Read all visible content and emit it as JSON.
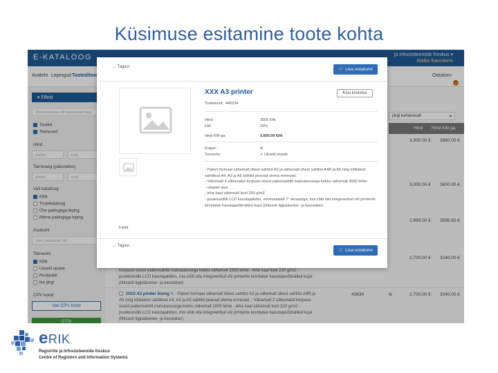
{
  "slide": {
    "title": "Küsimuse esitamine toote kohta"
  },
  "app": {
    "logo": "E-KATALOOG",
    "org_name": "ja Infosüsteemide Keskus",
    "user_name": "Maiko Kannikere",
    "nav": [
      "Avaleht",
      "Lepingud",
      "Tooted/teenu"
    ],
    "cart_label": "Ostukorv",
    "cart_count": "0"
  },
  "sidebar": {
    "filter_title": "Filtrid",
    "search_placeholder": "Otsi nimetuse või tootekoodi järgi",
    "types": [
      {
        "label": "Tooted",
        "checked": true
      },
      {
        "label": "Teenused",
        "checked": true
      }
    ],
    "price_label": "Hind",
    "price_from": "alates",
    "price_to": "kuni",
    "delivery_label": "Tarneaeg (päevades)",
    "delivery_from": "alates",
    "delivery_to": "kuni",
    "catalog_label": "Vali kataloog",
    "catalogs": [
      {
        "label": "Kõik",
        "checked": true
      },
      {
        "label": "Tootekataloog",
        "checked": false
      },
      {
        "label": "Ühe pakkujaga leping",
        "checked": false
      },
      {
        "label": "Mitme pakkujaga leping",
        "checked": false
      }
    ],
    "location_label": "Asukoht",
    "location_placeholder": "Linn, maakond, riik",
    "supply_label": "Tarneviis",
    "supplies": [
      {
        "label": "Kõik",
        "checked": true
      },
      {
        "label": "Uksetil ukseie",
        "checked": false
      },
      {
        "label": "Postipakk",
        "checked": false
      },
      {
        "label": "Ise järgi",
        "checked": false
      }
    ],
    "cpv_label": "CPV kood",
    "cpv_button": "Vali CPV kood",
    "search_button": "OTSI"
  },
  "main": {
    "sort_label": "järgi kahanevalt",
    "col_price": "Hind",
    "col_price_vat": "Hind KM-ga",
    "rows": [
      {
        "price": "3,300.00 €",
        "price_vat": "3960.00 €"
      },
      {
        "price": "3,000.00 €",
        "price_vat": "3600.00 €"
      },
      {
        "price": "2,999.00 €",
        "price_vat": "3598.80 €"
      },
      {
        "price": "2,700.00 €",
        "price_vat": "3240.00 €"
      },
      {
        "price": "2,700.00 €",
        "price_vat": "3240.00 €",
        "code": "43634",
        "unit": "tk"
      }
    ],
    "bg_text_1": "Korpuse sisest paberisahtlit mahutavusega kokku vähemalt 1000 lehte - lehe kaal kuni 220 g/m2 - puutetundlik LCD kasutajaliides, mis võib olla integreeritud või printerile kinnitatav kasutajasõbralikul kujul (lihtsasti ligipääsetav- ja kasutatav)",
    "bg_link": "OOO A3 printer liising",
    "bg_text_2": "- Paberi formaat vähemalt ühest sahtlist A3 ja vähemalt ühest sahtlist A4R ja A5 ning kõikidest sahtlitest A4. A3 ja A5 sahtlid peavad olema erinevad. - Vähemalt 2 sõltumatut korpuse sisest paberisahtlit mahutavusega kokku vähemalt 1000 lehte - lehe kaal vähemalt kuni 220 g/m2 - puutetundlik LCD kasutajaliides, mis võib olla integreeritud või printerile kinnitatav kasutajasõbralikul kujul (lihtsasti ligipääsetav- ja kasutatav)"
  },
  "modal": {
    "back_label": "Tagasi",
    "cart_button": "Lisa ostukorvi",
    "product_title": "XXX A3 printer",
    "product_code": "Tootekood : 446234",
    "ask_button": "Küsi küsimus",
    "spec": [
      {
        "key": "Hind:",
        "value": "3000 €/tk"
      },
      {
        "key": "KM:",
        "value": "20%"
      },
      {
        "key": "Hind KM-ga:",
        "value": "3,600.00 €/tk"
      },
      {
        "key": "Kogus:",
        "value": "tk"
      },
      {
        "key": "Tarneviis:",
        "value": "Uksetil ukseie"
      }
    ],
    "description": [
      "- Paberi formaat vähemalt ühest sahtlist A3 ja vähemalt ühest sahtlist A4R ja A5 ning kõikidest sahtlitest A4. A3 ja A5 sahtlid peavad olema erinevad.",
      "- Vähemalt 4 sõltumatut korpuse sisest paberisahtlit mahutavusega kokku vähemalt 3000 lehte",
      "- ratastel alus",
      "- lehe kaal vähemalt kuni 250 g/m2",
      "- puutetundlik LCD kasutajaliides, minimaalselt 7\" ekraaniga, mis võib olla integreeritud või printerile kinnitatav kasutajasõbralikul kujul (lihtsasti ligipääsetav- ja kasutatav)"
    ],
    "files_label": "Failid"
  },
  "logo": {
    "name": "RIK",
    "line1": "Registrite ja Infosüsteemide Keskus",
    "line2": "Centre of Registers and Information Systems",
    "brand_color": "#2d5fa6"
  }
}
